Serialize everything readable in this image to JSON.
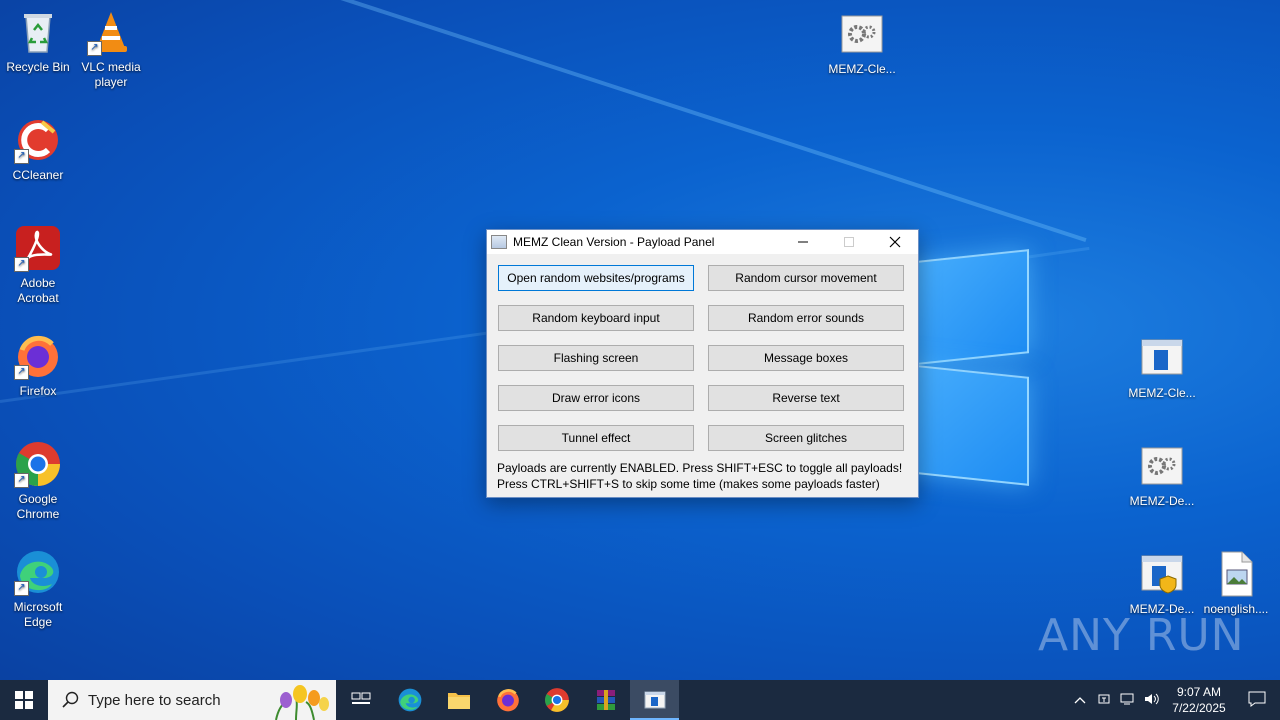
{
  "desktop_icons_left": [
    {
      "label": "Recycle Bin",
      "icon": "recycle-bin-icon"
    },
    {
      "label": "VLC media player",
      "icon": "vlc-icon"
    },
    {
      "label": "CCleaner",
      "icon": "ccleaner-icon"
    },
    {
      "label": "Adobe Acrobat",
      "icon": "acrobat-icon"
    },
    {
      "label": "Firefox",
      "icon": "firefox-icon"
    },
    {
      "label": "Google Chrome",
      "icon": "chrome-icon"
    },
    {
      "label": "Microsoft Edge",
      "icon": "edge-icon"
    }
  ],
  "desktop_icons_right": [
    {
      "label": "MEMZ-Cle...",
      "icon": "settings-file-icon"
    },
    {
      "label": "MEMZ-Cle...",
      "icon": "app-window-icon"
    },
    {
      "label": "MEMZ-De...",
      "icon": "settings-file-icon"
    },
    {
      "label": "MEMZ-De...",
      "icon": "shield-app-icon"
    },
    {
      "label": "noenglish....",
      "icon": "image-file-icon"
    }
  ],
  "window": {
    "title": "MEMZ Clean Version - Payload Panel",
    "buttons": [
      "Open random websites/programs",
      "Random cursor movement",
      "Random keyboard input",
      "Random error sounds",
      "Flashing screen",
      "Message boxes",
      "Draw error icons",
      "Reverse text",
      "Tunnel effect",
      "Screen glitches"
    ],
    "status_line1": "Payloads are currently ENABLED. Press SHIFT+ESC to toggle all payloads!",
    "status_line2": "Press CTRL+SHIFT+S to skip some time (makes some payloads faster)"
  },
  "taskbar": {
    "search_placeholder": "Type here to search",
    "time": "9:07 AM",
    "date": "7/22/2025"
  },
  "watermark": "ANY RUN"
}
